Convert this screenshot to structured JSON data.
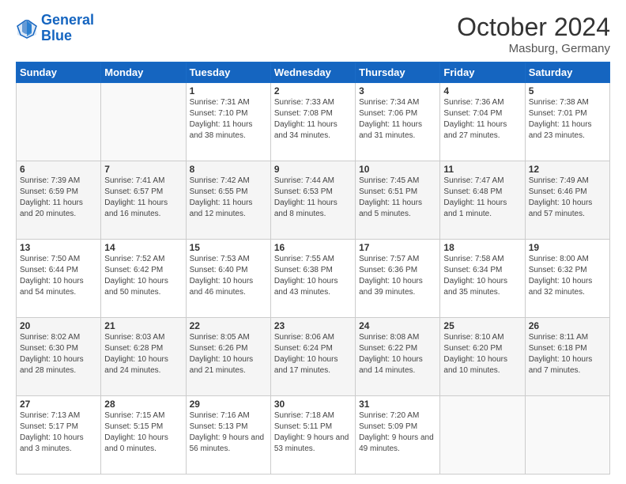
{
  "logo": {
    "line1": "General",
    "line2": "Blue"
  },
  "title": "October 2024",
  "location": "Masburg, Germany",
  "weekdays": [
    "Sunday",
    "Monday",
    "Tuesday",
    "Wednesday",
    "Thursday",
    "Friday",
    "Saturday"
  ],
  "weeks": [
    [
      {
        "day": "",
        "sunrise": "",
        "sunset": "",
        "daylight": ""
      },
      {
        "day": "",
        "sunrise": "",
        "sunset": "",
        "daylight": ""
      },
      {
        "day": "1",
        "sunrise": "Sunrise: 7:31 AM",
        "sunset": "Sunset: 7:10 PM",
        "daylight": "Daylight: 11 hours and 38 minutes."
      },
      {
        "day": "2",
        "sunrise": "Sunrise: 7:33 AM",
        "sunset": "Sunset: 7:08 PM",
        "daylight": "Daylight: 11 hours and 34 minutes."
      },
      {
        "day": "3",
        "sunrise": "Sunrise: 7:34 AM",
        "sunset": "Sunset: 7:06 PM",
        "daylight": "Daylight: 11 hours and 31 minutes."
      },
      {
        "day": "4",
        "sunrise": "Sunrise: 7:36 AM",
        "sunset": "Sunset: 7:04 PM",
        "daylight": "Daylight: 11 hours and 27 minutes."
      },
      {
        "day": "5",
        "sunrise": "Sunrise: 7:38 AM",
        "sunset": "Sunset: 7:01 PM",
        "daylight": "Daylight: 11 hours and 23 minutes."
      }
    ],
    [
      {
        "day": "6",
        "sunrise": "Sunrise: 7:39 AM",
        "sunset": "Sunset: 6:59 PM",
        "daylight": "Daylight: 11 hours and 20 minutes."
      },
      {
        "day": "7",
        "sunrise": "Sunrise: 7:41 AM",
        "sunset": "Sunset: 6:57 PM",
        "daylight": "Daylight: 11 hours and 16 minutes."
      },
      {
        "day": "8",
        "sunrise": "Sunrise: 7:42 AM",
        "sunset": "Sunset: 6:55 PM",
        "daylight": "Daylight: 11 hours and 12 minutes."
      },
      {
        "day": "9",
        "sunrise": "Sunrise: 7:44 AM",
        "sunset": "Sunset: 6:53 PM",
        "daylight": "Daylight: 11 hours and 8 minutes."
      },
      {
        "day": "10",
        "sunrise": "Sunrise: 7:45 AM",
        "sunset": "Sunset: 6:51 PM",
        "daylight": "Daylight: 11 hours and 5 minutes."
      },
      {
        "day": "11",
        "sunrise": "Sunrise: 7:47 AM",
        "sunset": "Sunset: 6:48 PM",
        "daylight": "Daylight: 11 hours and 1 minute."
      },
      {
        "day": "12",
        "sunrise": "Sunrise: 7:49 AM",
        "sunset": "Sunset: 6:46 PM",
        "daylight": "Daylight: 10 hours and 57 minutes."
      }
    ],
    [
      {
        "day": "13",
        "sunrise": "Sunrise: 7:50 AM",
        "sunset": "Sunset: 6:44 PM",
        "daylight": "Daylight: 10 hours and 54 minutes."
      },
      {
        "day": "14",
        "sunrise": "Sunrise: 7:52 AM",
        "sunset": "Sunset: 6:42 PM",
        "daylight": "Daylight: 10 hours and 50 minutes."
      },
      {
        "day": "15",
        "sunrise": "Sunrise: 7:53 AM",
        "sunset": "Sunset: 6:40 PM",
        "daylight": "Daylight: 10 hours and 46 minutes."
      },
      {
        "day": "16",
        "sunrise": "Sunrise: 7:55 AM",
        "sunset": "Sunset: 6:38 PM",
        "daylight": "Daylight: 10 hours and 43 minutes."
      },
      {
        "day": "17",
        "sunrise": "Sunrise: 7:57 AM",
        "sunset": "Sunset: 6:36 PM",
        "daylight": "Daylight: 10 hours and 39 minutes."
      },
      {
        "day": "18",
        "sunrise": "Sunrise: 7:58 AM",
        "sunset": "Sunset: 6:34 PM",
        "daylight": "Daylight: 10 hours and 35 minutes."
      },
      {
        "day": "19",
        "sunrise": "Sunrise: 8:00 AM",
        "sunset": "Sunset: 6:32 PM",
        "daylight": "Daylight: 10 hours and 32 minutes."
      }
    ],
    [
      {
        "day": "20",
        "sunrise": "Sunrise: 8:02 AM",
        "sunset": "Sunset: 6:30 PM",
        "daylight": "Daylight: 10 hours and 28 minutes."
      },
      {
        "day": "21",
        "sunrise": "Sunrise: 8:03 AM",
        "sunset": "Sunset: 6:28 PM",
        "daylight": "Daylight: 10 hours and 24 minutes."
      },
      {
        "day": "22",
        "sunrise": "Sunrise: 8:05 AM",
        "sunset": "Sunset: 6:26 PM",
        "daylight": "Daylight: 10 hours and 21 minutes."
      },
      {
        "day": "23",
        "sunrise": "Sunrise: 8:06 AM",
        "sunset": "Sunset: 6:24 PM",
        "daylight": "Daylight: 10 hours and 17 minutes."
      },
      {
        "day": "24",
        "sunrise": "Sunrise: 8:08 AM",
        "sunset": "Sunset: 6:22 PM",
        "daylight": "Daylight: 10 hours and 14 minutes."
      },
      {
        "day": "25",
        "sunrise": "Sunrise: 8:10 AM",
        "sunset": "Sunset: 6:20 PM",
        "daylight": "Daylight: 10 hours and 10 minutes."
      },
      {
        "day": "26",
        "sunrise": "Sunrise: 8:11 AM",
        "sunset": "Sunset: 6:18 PM",
        "daylight": "Daylight: 10 hours and 7 minutes."
      }
    ],
    [
      {
        "day": "27",
        "sunrise": "Sunrise: 7:13 AM",
        "sunset": "Sunset: 5:17 PM",
        "daylight": "Daylight: 10 hours and 3 minutes."
      },
      {
        "day": "28",
        "sunrise": "Sunrise: 7:15 AM",
        "sunset": "Sunset: 5:15 PM",
        "daylight": "Daylight: 10 hours and 0 minutes."
      },
      {
        "day": "29",
        "sunrise": "Sunrise: 7:16 AM",
        "sunset": "Sunset: 5:13 PM",
        "daylight": "Daylight: 9 hours and 56 minutes."
      },
      {
        "day": "30",
        "sunrise": "Sunrise: 7:18 AM",
        "sunset": "Sunset: 5:11 PM",
        "daylight": "Daylight: 9 hours and 53 minutes."
      },
      {
        "day": "31",
        "sunrise": "Sunrise: 7:20 AM",
        "sunset": "Sunset: 5:09 PM",
        "daylight": "Daylight: 9 hours and 49 minutes."
      },
      {
        "day": "",
        "sunrise": "",
        "sunset": "",
        "daylight": ""
      },
      {
        "day": "",
        "sunrise": "",
        "sunset": "",
        "daylight": ""
      }
    ]
  ]
}
